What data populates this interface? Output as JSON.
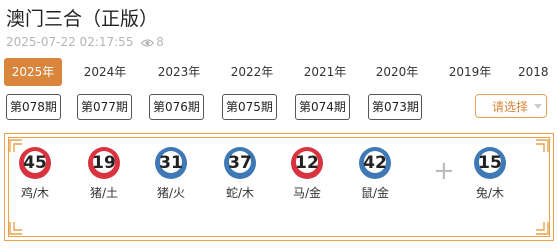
{
  "header": {
    "title": "澳门三合（正版）",
    "datetime": "2025-07-22 02:17:55",
    "views": "8"
  },
  "year_tabs": [
    {
      "label": "2025年",
      "active": true
    },
    {
      "label": "2024年",
      "active": false
    },
    {
      "label": "2023年",
      "active": false
    },
    {
      "label": "2022年",
      "active": false
    },
    {
      "label": "2021年",
      "active": false
    },
    {
      "label": "2020年",
      "active": false
    },
    {
      "label": "2019年",
      "active": false
    },
    {
      "label": "2018",
      "active": false
    }
  ],
  "issues": [
    "第078期",
    "第077期",
    "第076期",
    "第075期",
    "第074期",
    "第073期"
  ],
  "select": {
    "label": "请选择"
  },
  "balls": [
    {
      "number": "45",
      "zodiac": "鸡/木",
      "color": "red"
    },
    {
      "number": "19",
      "zodiac": "猪/土",
      "color": "red"
    },
    {
      "number": "31",
      "zodiac": "猪/火",
      "color": "blue"
    },
    {
      "number": "37",
      "zodiac": "蛇/木",
      "color": "blue"
    },
    {
      "number": "12",
      "zodiac": "马/金",
      "color": "red"
    },
    {
      "number": "42",
      "zodiac": "鼠/金",
      "color": "blue"
    }
  ],
  "plus": "+",
  "special": {
    "number": "15",
    "zodiac": "兔/木",
    "color": "blue"
  },
  "colors": {
    "accent": "#d9853b",
    "red": "#d9333f",
    "blue": "#3e79b5",
    "frame": "#e8a24a"
  },
  "icons": {
    "views": "eye-icon",
    "select": "chevron-down-icon"
  }
}
